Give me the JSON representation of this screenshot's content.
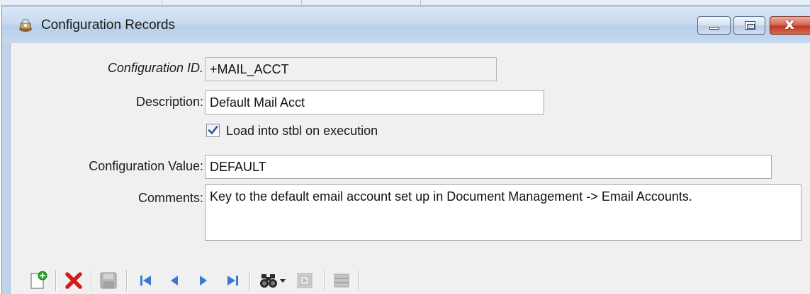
{
  "window": {
    "title": "Configuration Records",
    "icons": {
      "app": "app-icon",
      "minimize": "minimize-icon",
      "maximize": "maximize-icon",
      "close": "close-icon"
    },
    "close_glyph": "x"
  },
  "form": {
    "config_id": {
      "label": "Configuration ID.",
      "value": "+MAIL_ACCT"
    },
    "description": {
      "label": "Description:",
      "value": "Default Mail Acct"
    },
    "load_stbl": {
      "label": "Load into stbl on execution",
      "checked": true
    },
    "config_value": {
      "label": "Configuration Value:",
      "value": "DEFAULT"
    },
    "comments": {
      "label": "Comments:",
      "value": "Key to the default email account set up in Document Management -> Email Accounts."
    }
  },
  "toolbar": {
    "icons": [
      "new-record-icon",
      "delete-icon",
      "save-icon",
      "first-record-icon",
      "previous-record-icon",
      "next-record-icon",
      "last-record-icon",
      "find-icon",
      "dropdown-arrow-icon",
      "lookup-icon",
      "grid-icon"
    ]
  },
  "colors": {
    "title_gradient": "#c9dbf0",
    "close_red": "#c0391f",
    "nav_blue": "#3a78d6",
    "delete_red": "#d61a1a",
    "new_green": "#2aa62a"
  }
}
